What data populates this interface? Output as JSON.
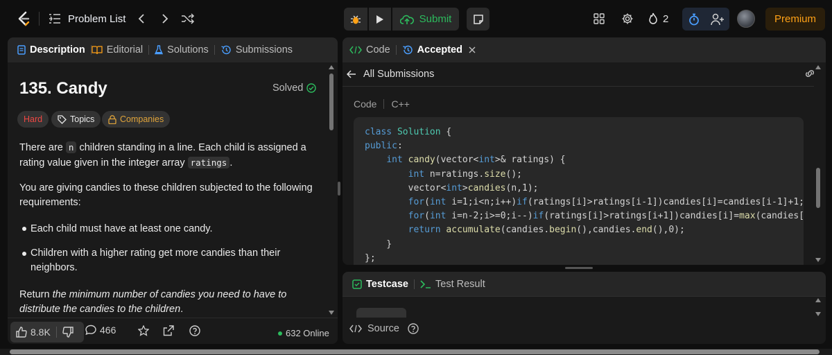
{
  "topbar": {
    "problem_list": "Problem List",
    "submit": "Submit",
    "streak_count": "2",
    "premium": "Premium"
  },
  "left": {
    "tabs": [
      {
        "label": "Description",
        "icon": "description-icon"
      },
      {
        "label": "Editorial",
        "icon": "book-icon"
      },
      {
        "label": "Solutions",
        "icon": "flask-icon"
      },
      {
        "label": "Submissions",
        "icon": "history-icon"
      }
    ],
    "title": "135. Candy",
    "solved": "Solved",
    "difficulty": "Hard",
    "topics": "Topics",
    "companies": "Companies",
    "para1_a": "There are ",
    "para1_code1": "n",
    "para1_b": " children standing in a line. Each child is assigned a",
    "para1_c": "rating value given in the integer array ",
    "para1_code2": "ratings",
    "para1_d": ".",
    "para2_a": "You are giving candies to these children subjected to the following",
    "para2_b": "requirements:",
    "bullet1": "Each child must have at least one candy.",
    "bullet2_a": "Children with a higher rating get more candies than their",
    "bullet2_b": "neighbors.",
    "return_a": "Return ",
    "return_b": "the minimum number of candies you need to have to",
    "return_c": "distribute the candies to the children",
    "return_d": ".",
    "likes": "8.8K",
    "comments": "466",
    "online": "632 Online"
  },
  "code_panel": {
    "tab_code": "Code",
    "tab_accepted": "Accepted",
    "all_submissions": "All Submissions",
    "code_label": "Code",
    "language": "C++"
  },
  "test_panel": {
    "tab_testcase": "Testcase",
    "tab_result": "Test Result",
    "source": "Source"
  },
  "colors": {
    "accent_green": "#2cbb5d",
    "premium_orange": "#ffa116",
    "hard_red": "#ef4743",
    "companies_gold": "#e0a43a",
    "link_blue": "#4a9eff"
  }
}
